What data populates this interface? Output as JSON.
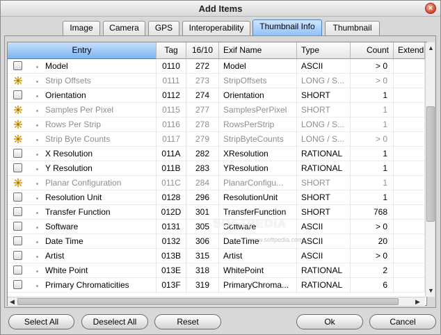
{
  "window": {
    "title": "Add Items"
  },
  "tabs": [
    {
      "label": "Image",
      "active": false
    },
    {
      "label": "Camera",
      "active": false
    },
    {
      "label": "GPS",
      "active": false
    },
    {
      "label": "Interoperability",
      "active": false
    },
    {
      "label": "Thumbnail Info",
      "active": true
    },
    {
      "label": "Thumbnail",
      "active": false
    }
  ],
  "table": {
    "headers": {
      "entry": "Entry",
      "tag": "Tag",
      "dec": "16/10",
      "exif": "Exif Name",
      "type": "Type",
      "count": "Count",
      "extend": "Extend"
    },
    "rows": [
      {
        "icon": "checkbox",
        "entry": "Model",
        "tag": "0110",
        "dec": "272",
        "exif": "Model",
        "type": "ASCII",
        "count": "> 0",
        "disabled": false
      },
      {
        "icon": "lock-icon",
        "entry": "Strip Offsets",
        "tag": "0111",
        "dec": "273",
        "exif": "StripOffsets",
        "type": "LONG / S...",
        "count": "> 0",
        "disabled": true
      },
      {
        "icon": "checkbox",
        "entry": "Orientation",
        "tag": "0112",
        "dec": "274",
        "exif": "Orientation",
        "type": "SHORT",
        "count": "1",
        "disabled": false
      },
      {
        "icon": "lock-icon",
        "entry": "Samples Per Pixel",
        "tag": "0115",
        "dec": "277",
        "exif": "SamplesPerPixel",
        "type": "SHORT",
        "count": "1",
        "disabled": true
      },
      {
        "icon": "lock-icon",
        "entry": "Rows Per Strip",
        "tag": "0116",
        "dec": "278",
        "exif": "RowsPerStrip",
        "type": "LONG / S...",
        "count": "1",
        "disabled": true
      },
      {
        "icon": "lock-icon",
        "entry": "Strip Byte Counts",
        "tag": "0117",
        "dec": "279",
        "exif": "StripByteCounts",
        "type": "LONG / S...",
        "count": "> 0",
        "disabled": true
      },
      {
        "icon": "checkbox",
        "entry": "X Resolution",
        "tag": "011A",
        "dec": "282",
        "exif": "XResolution",
        "type": "RATIONAL",
        "count": "1",
        "disabled": false
      },
      {
        "icon": "checkbox",
        "entry": "Y Resolution",
        "tag": "011B",
        "dec": "283",
        "exif": "YResolution",
        "type": "RATIONAL",
        "count": "1",
        "disabled": false
      },
      {
        "icon": "lock-icon",
        "entry": "Planar Configuration",
        "tag": "011C",
        "dec": "284",
        "exif": "PlanarConfigu...",
        "type": "SHORT",
        "count": "1",
        "disabled": true
      },
      {
        "icon": "checkbox",
        "entry": "Resolution Unit",
        "tag": "0128",
        "dec": "296",
        "exif": "ResolutionUnit",
        "type": "SHORT",
        "count": "1",
        "disabled": false
      },
      {
        "icon": "checkbox",
        "entry": "Transfer Function",
        "tag": "012D",
        "dec": "301",
        "exif": "TransferFunction",
        "type": "SHORT",
        "count": "768",
        "disabled": false
      },
      {
        "icon": "checkbox",
        "entry": "Software",
        "tag": "0131",
        "dec": "305",
        "exif": "Software",
        "type": "ASCII",
        "count": "> 0",
        "disabled": false
      },
      {
        "icon": "checkbox",
        "entry": "Date Time",
        "tag": "0132",
        "dec": "306",
        "exif": "DateTime",
        "type": "ASCII",
        "count": "20",
        "disabled": false
      },
      {
        "icon": "checkbox",
        "entry": "Artist",
        "tag": "013B",
        "dec": "315",
        "exif": "Artist",
        "type": "ASCII",
        "count": "> 0",
        "disabled": false
      },
      {
        "icon": "checkbox",
        "entry": "White Point",
        "tag": "013E",
        "dec": "318",
        "exif": "WhitePoint",
        "type": "RATIONAL",
        "count": "2",
        "disabled": false
      },
      {
        "icon": "checkbox",
        "entry": "Primary Chromaticities",
        "tag": "013F",
        "dec": "319",
        "exif": "PrimaryChroma...",
        "type": "RATIONAL",
        "count": "6",
        "disabled": false
      }
    ]
  },
  "buttons": {
    "select_all": "Select All",
    "deselect_all": "Deselect All",
    "reset": "Reset",
    "ok": "Ok",
    "cancel": "Cancel"
  },
  "watermark": {
    "main": "SOFTPEDIA",
    "sub": "www.softpedia.com"
  },
  "colors": {
    "accent": "#8fc0f5",
    "disabled_text": "#8e8e8e"
  }
}
